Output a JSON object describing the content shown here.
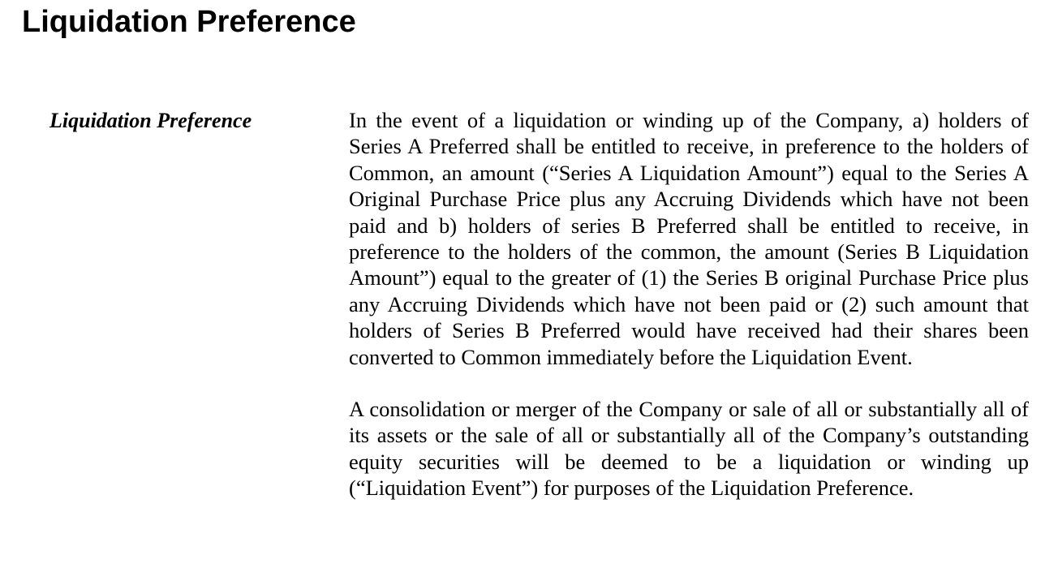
{
  "document": {
    "heading": "Liquidation Preference",
    "section": {
      "label": "Liquidation Preference",
      "paragraphs": [
        "In the event of a liquidation or winding up of the Company, a) holders of Series A Preferred shall be entitled to receive, in preference to the holders of Common, an amount (“Series A Liquidation Amount”) equal to the Series A Original Purchase Price plus any Accruing Dividends which have not been paid and b) holders of series B Preferred shall be entitled to receive, in preference to the holders of the common, the amount (Series B Liquidation Amount”) equal to the greater of (1) the Series B original Purchase Price plus any Accruing Dividends which have not been paid or (2) such amount that holders of Series B Preferred would have received had their shares been converted to Common immediately before the Liquidation Event.",
        "A consolidation or merger of the Company or sale of all or substantially all of its assets or the sale of all or substantially all of the Company’s outstanding equity securities will be deemed to be a liquidation or winding up (“Liquidation Event”) for purposes of the Liquidation Preference."
      ]
    }
  }
}
